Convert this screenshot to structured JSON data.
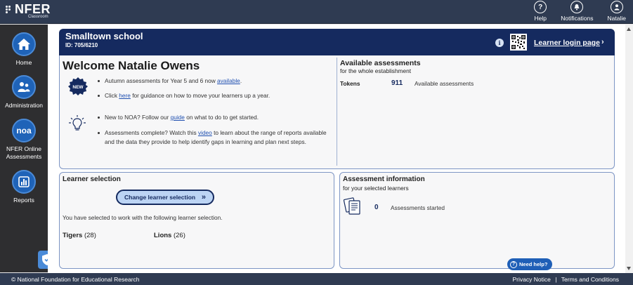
{
  "brand": {
    "name": "NFER",
    "sub": "Classroom"
  },
  "topnav": [
    {
      "label": "Help",
      "icon": "help-icon"
    },
    {
      "label": "Notifications",
      "icon": "bell-icon"
    },
    {
      "label": "Natalie",
      "icon": "user-icon"
    }
  ],
  "sidebar": {
    "items": [
      {
        "label": "Home",
        "icon": "home-icon"
      },
      {
        "label": "Administration",
        "icon": "people-icon"
      },
      {
        "label": "NFER Online Assessments",
        "icon": "noa-icon",
        "icon_text": "noa"
      },
      {
        "label": "Reports",
        "icon": "bar-chart-icon"
      }
    ]
  },
  "school": {
    "name": "Smalltown school",
    "id": "ID: 705/6210",
    "login_link": "Learner login page",
    "chevron": "›",
    "info": "i"
  },
  "welcome": {
    "title": "Welcome Natalie Owens",
    "badge": "NEW",
    "bullet1_pre": "Autumn assessments for Year 5 and 6 now ",
    "bullet1_link": "available",
    "bullet1_post": ".",
    "bullet2_pre": "Click ",
    "bullet2_link": "here",
    "bullet2_post": " for guidance on how to move your learners up a year.",
    "bullet3_pre": "New to NOA? Follow our ",
    "bullet3_link": "guide",
    "bullet3_post": " on what to do to get started.",
    "bullet4_pre": "Assessments complete? Watch this ",
    "bullet4_link": "video",
    "bullet4_post": " to learn about the range of reports available and the data they provide to help identify gaps in learning and plan next steps."
  },
  "available": {
    "title": "Available assessments",
    "subtitle": "for the whole establishment",
    "tokens_label": "Tokens",
    "tokens_value": "911",
    "tokens_text": "Available assessments"
  },
  "learner_selection": {
    "title": "Learner selection",
    "button": "Change learner selection",
    "button_arrow": "»",
    "text": "You have selected to work with the following learner selection.",
    "groups": [
      {
        "name": "Tigers",
        "count": "(28)"
      },
      {
        "name": "Lions",
        "count": "(26)"
      }
    ]
  },
  "assessment_info": {
    "title": "Assessment information",
    "subtitle": "for your selected learners",
    "value": "0",
    "text": "Assessments started"
  },
  "help_button": "Need help?",
  "footer": {
    "copyright": "© National Foundation for Educational Research",
    "privacy": "Privacy Notice",
    "separator": "|",
    "terms": "Terms and Conditions"
  },
  "colors": {
    "navy": "#152a5f",
    "topbar": "#2f3b52",
    "accent": "#1f63b8",
    "panel_border": "#7d95c4"
  }
}
